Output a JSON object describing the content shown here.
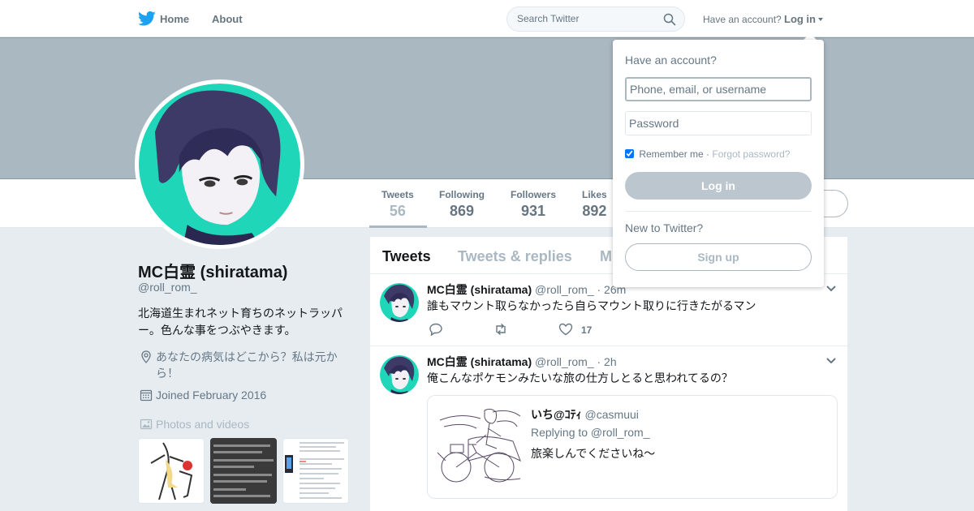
{
  "topbar": {
    "home_label": "Home",
    "about_label": "About",
    "search_placeholder": "Search Twitter",
    "have_account": "Have an account?",
    "login_label": "Log in"
  },
  "profile": {
    "name": "MC白霊 (shiratama)",
    "handle": "@roll_rom_",
    "bio": "北海道生まれネット育ちのネットラッパー。色んな事をつぶやきます。",
    "location": "あなたの病気はどこから？私は元から！",
    "joined": "Joined February 2016",
    "photos_label": "Photos and videos"
  },
  "stats": [
    {
      "label": "Tweets",
      "value": "56"
    },
    {
      "label": "Following",
      "value": "869"
    },
    {
      "label": "Followers",
      "value": "931"
    },
    {
      "label": "Likes",
      "value": "892"
    }
  ],
  "tabs": [
    "Tweets",
    "Tweets & replies",
    "M"
  ],
  "tweets": [
    {
      "name": "MC白霊 (shiratama)",
      "handle": "@roll_rom_",
      "time": "· 26m",
      "text": "誰もマウント取らなかったら自らマウント取りに行きたがるマン",
      "likes": "17"
    },
    {
      "name": "MC白霊 (shiratama)",
      "handle": "@roll_rom_",
      "time": "· 2h",
      "text": "俺こんなポケモンみたいな旅の仕方しとると思われてるの？",
      "quote": {
        "name": "いち@ｺﾃｨ",
        "handle": "@casmuui",
        "replying": "Replying to @roll_rom_",
        "text": "旅楽しんでくださいね〜"
      }
    }
  ],
  "dropdown": {
    "title": "Have an account?",
    "username_placeholder": "Phone, email, or username",
    "password_placeholder": "Password",
    "remember": "Remember me",
    "separator": "·",
    "forgot": "Forgot password?",
    "login_button": "Log in",
    "new_to": "New to Twitter?",
    "signup_button": "Sign up"
  },
  "colors": {
    "banner": "#aab8c2",
    "avatar_bg": "#1fd6b8",
    "twitter_blue": "#1da1f2"
  }
}
